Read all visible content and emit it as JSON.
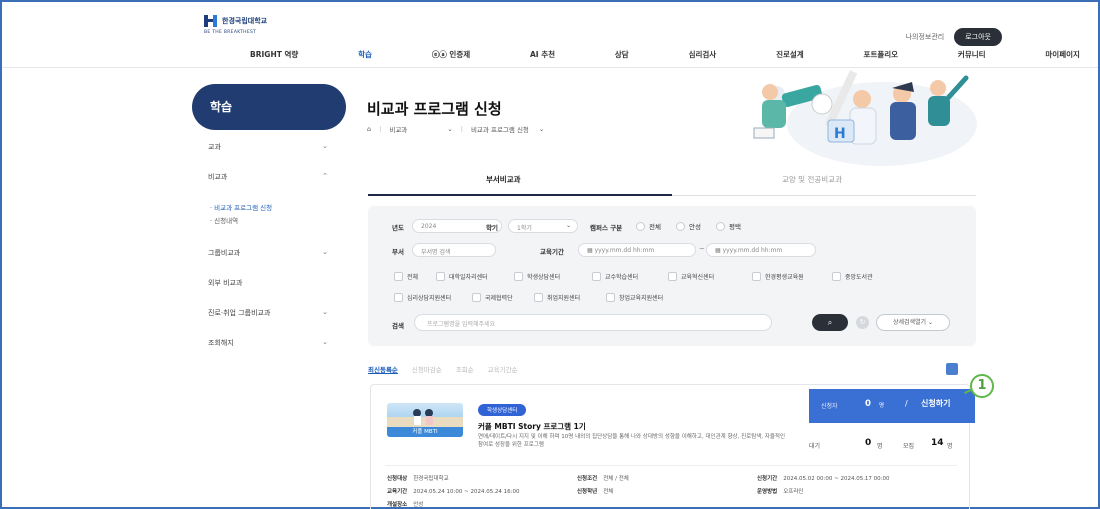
{
  "header": {
    "logo_name": "한경국립대학교",
    "logo_sub": "BE THE BREAKTHEST",
    "util_link": "나의정보관리",
    "login_label": "로그아웃",
    "gnb": [
      "BRIGHT 역량",
      "학습",
      "ⓔⓐ 인증제",
      "AI 추천",
      "상담",
      "심리검사",
      "진로설계",
      "포트폴리오",
      "커뮤니티",
      "마이페이지"
    ]
  },
  "lnb": {
    "title": "학습",
    "items": [
      "교과",
      "비교과",
      "그룹비교과",
      "외부 비교과",
      "진로·취업 그룹비교과",
      "조회해지"
    ],
    "sub_items": [
      "· 비교과 프로그램 신청",
      "· 신청내역"
    ]
  },
  "main": {
    "page_title": "비교과 프로그램 신청",
    "breadcrumb": [
      "비교과",
      "비교과 프로그램 신청"
    ]
  },
  "tabs": [
    "부서비교과",
    "교양 및 전공비교과"
  ],
  "filter": {
    "year_label": "년도",
    "year_value": "2024",
    "term_label": "학기",
    "term_value": "1학기",
    "campus_label": "캠퍼스 구분",
    "campus_options": [
      "전체",
      "안성",
      "평택"
    ],
    "dept_label": "부서",
    "dept_placeholder": "부서명 검색",
    "period_label": "교육기간",
    "date_placeholder": "yyyy.mm.dd hh:mm",
    "centers": [
      "전체",
      "대학일자리센터",
      "학생상담센터",
      "교수학습센터",
      "교육혁신센터",
      "한경평생교육원",
      "중앙도서관",
      "심리상담지원센터",
      "국제협력단",
      "취업지원센터",
      "창업교육지원센터"
    ],
    "search_label": "검색",
    "search_placeholder": "프로그램명을 입력해주세요",
    "search_icon": "search-icon",
    "adv_label": "상세검색열기"
  },
  "sort": [
    "최신등록순",
    "신청마감순",
    "조회순",
    "교육기간순"
  ],
  "card": {
    "badge": "학생상담센터",
    "title": "커플 MBTI Story 프로그램 1기",
    "desc": "연애/데이트/다시 지지 및 이해 하며 10명 내외의 집단상담을 통해 나와 상대방의 성향을 이해하고, 대인관계 향상, 진로탐색, 자율적인 참여로 성장을 위한 프로그램",
    "thumb_caption": "커플 MBTI",
    "apply_count_label": "신청자",
    "apply_count": "0",
    "unit": "명",
    "apply_label": "신청하기",
    "wait_label": "대기",
    "wait_count": "0",
    "capacity_label": "모집",
    "capacity": "14",
    "info": [
      {
        "k": "신청대상",
        "v": "한경국립대학교"
      },
      {
        "k": "교육기간",
        "v": "2024.05.24 10:00 ~ 2024.05.24 16:00"
      },
      {
        "k": "개설장소",
        "v": "안성"
      },
      {
        "k": "신청조건",
        "v": "전체 / 전체"
      },
      {
        "k": "신청학년",
        "v": "전체"
      },
      {
        "k": "신청기간",
        "v": "2024.05.02 00:00 ~ 2024.05.17 00:00"
      },
      {
        "k": "운영방법",
        "v": "오프라인"
      }
    ]
  },
  "marker": "1"
}
